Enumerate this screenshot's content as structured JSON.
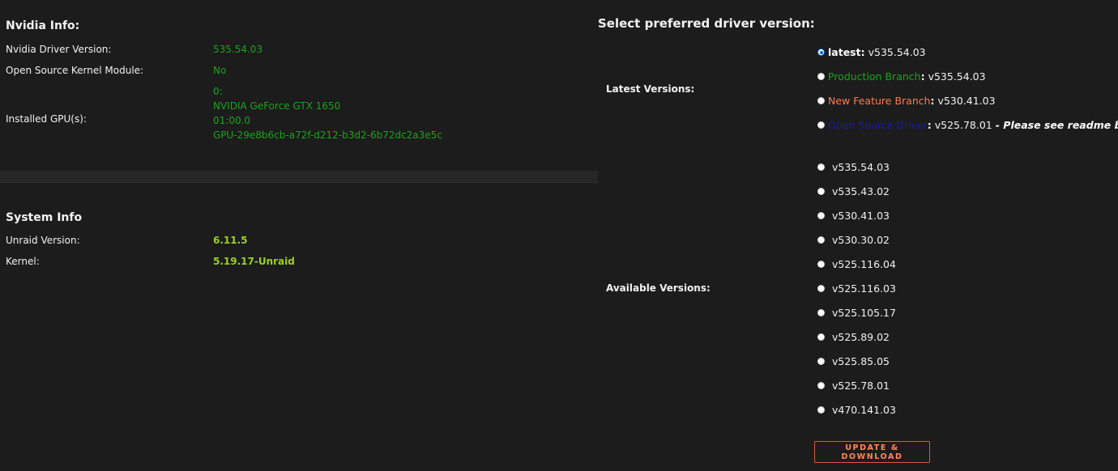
{
  "nvidia_info": {
    "title": "Nvidia Info:",
    "rows": {
      "driver_version": {
        "label": "Nvidia Driver Version:",
        "value": "535.54.03"
      },
      "open_source_kernel": {
        "label": "Open Source Kernel Module:",
        "value": "No"
      },
      "installed_gpus": {
        "label": "Installed GPU(s):",
        "lines": [
          "0:",
          "NVIDIA GeForce GTX 1650",
          "01:00.0",
          "GPU-29e8b6cb-a72f-d212-b3d2-6b72dc2a3e5c"
        ]
      }
    }
  },
  "system_info": {
    "title": "System Info",
    "rows": {
      "unraid_version": {
        "label": "Unraid Version:",
        "value": "6.11.5"
      },
      "kernel": {
        "label": "Kernel:",
        "value": "5.19.17-Unraid"
      }
    }
  },
  "driver_select": {
    "title": "Select preferred driver version:",
    "latest_label": "Latest Versions:",
    "available_label": "Available Versions:",
    "latest_options": [
      {
        "name": "latest",
        "suffix": ":",
        "version": "v535.54.03",
        "note": "",
        "checked": true
      },
      {
        "name": "Production Branch",
        "suffix": ":",
        "version": "v535.54.03",
        "note": "",
        "checked": false
      },
      {
        "name": "New Feature Branch",
        "suffix": ":",
        "version": "v530.41.03",
        "note": "",
        "checked": false
      },
      {
        "name": "Open Source Driver",
        "suffix": ":",
        "version": "v525.78.01",
        "note": "- Please see readme below!",
        "checked": false
      }
    ],
    "available_versions": [
      "v535.54.03",
      "v535.43.02",
      "v530.41.03",
      "v530.30.02",
      "v525.116.04",
      "v525.116.03",
      "v525.105.17",
      "v525.89.02",
      "v525.85.05",
      "v525.78.01",
      "v470.141.03"
    ],
    "button_label": "UPDATE & DOWNLOAD"
  },
  "colors": {
    "background": "#1c1c1c",
    "value_green": "#1aa31a",
    "value_yellow": "#9bd11c",
    "orange": "#ff7a4d",
    "blue": "#1a1aaa",
    "button_border": "#e05a2a"
  }
}
